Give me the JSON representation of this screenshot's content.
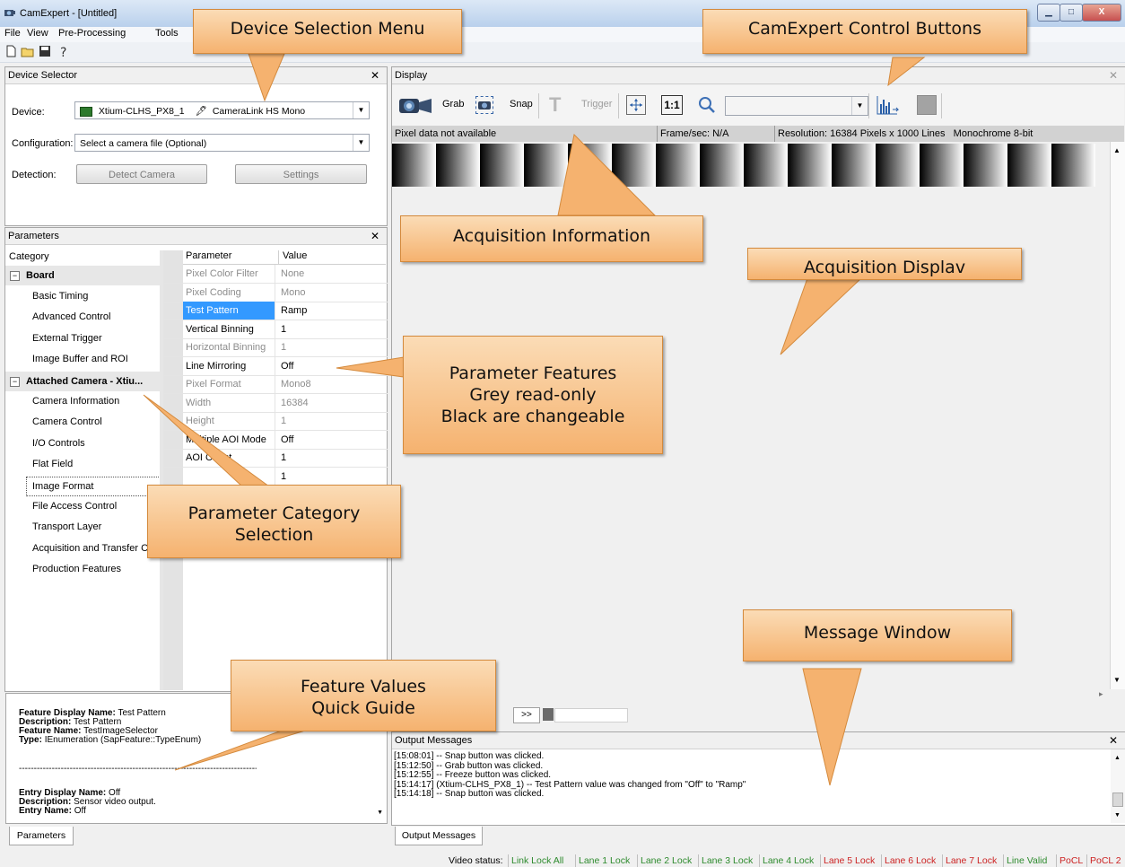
{
  "window": {
    "title": "CamExpert - [Untitled]",
    "min": "▁",
    "max": "□",
    "close": "X"
  },
  "menu": [
    "File",
    "View",
    "Pre-Processing",
    "Tools"
  ],
  "device_selector": {
    "header": "Device Selector",
    "device_label": "Device:",
    "device_value": "Xtium-CLHS_PX8_1",
    "device_type": "CameraLink HS Mono",
    "config_label": "Configuration:",
    "config_value": "Select a camera file (Optional)",
    "detection_label": "Detection:",
    "detect_button": "Detect Camera",
    "settings_button": "Settings"
  },
  "parameters": {
    "header": "Parameters",
    "col_category": "Category",
    "col_parameter": "Parameter",
    "col_value": "Value",
    "categories": [
      {
        "label": "Board",
        "group": true
      },
      {
        "label": "Basic Timing"
      },
      {
        "label": "Advanced Control"
      },
      {
        "label": "External Trigger"
      },
      {
        "label": "Image Buffer and ROI"
      },
      {
        "label": "Attached Camera - Xtiu...",
        "group": true
      },
      {
        "label": "Camera Information"
      },
      {
        "label": "Camera Control"
      },
      {
        "label": "I/O Controls"
      },
      {
        "label": "Flat Field"
      },
      {
        "label": "Image Format"
      },
      {
        "label": "File Access Control"
      },
      {
        "label": "Transport Layer"
      },
      {
        "label": "Acquisition and Transfer C"
      },
      {
        "label": "Production Features"
      }
    ],
    "rows": [
      {
        "name": "Pixel Color Filter",
        "value": "None",
        "readonly": true
      },
      {
        "name": "Pixel Coding",
        "value": "Mono",
        "readonly": true
      },
      {
        "name": "Test Pattern",
        "value": "Ramp",
        "selected": true
      },
      {
        "name": "Vertical Binning",
        "value": "1"
      },
      {
        "name": "Horizontal Binning",
        "value": "1",
        "readonly": true
      },
      {
        "name": "Line Mirroring",
        "value": "Off"
      },
      {
        "name": "Pixel Format",
        "value": "Mono8",
        "readonly": true
      },
      {
        "name": "Width",
        "value": "16384",
        "readonly": true
      },
      {
        "name": "Height",
        "value": "1",
        "readonly": true
      },
      {
        "name": "Multiple AOI Mode",
        "value": "Off"
      },
      {
        "name": "AOI Count",
        "value": "1"
      },
      {
        "name": "",
        "value": "1"
      }
    ],
    "info": {
      "l1_key": "Feature Display Name:",
      "l1_val": "Test Pattern",
      "l2_key": "Description:",
      "l2_val": "Test Pattern",
      "l3_key": "Feature Name:",
      "l3_val": "TestImageSelector",
      "l4_key": "Type:",
      "l4_val": "IEnumeration (SapFeature::TypeEnum)",
      "sep": "----------------------------------------------------------------------------------------",
      "l5_key": "Entry Display Name:",
      "l5_val": "Off",
      "l6_key": "Description:",
      "l6_val": "Sensor video output.",
      "l7_key": "Entry Name:",
      "l7_val": "Off"
    },
    "tab": "Parameters"
  },
  "display": {
    "header": "Display",
    "grab": "Grab",
    "snap": "Snap",
    "trigger": "Trigger",
    "one_to_one": "1:1",
    "pixel_info": "Pixel data not available",
    "fps": "Frame/sec: N/A",
    "resolution": "Resolution: 16384 Pixels x 1000 Lines   Monochrome 8-bit",
    "nav_next": ">>"
  },
  "output": {
    "header": "Output Messages",
    "messages": [
      "[15:08:01] -- Snap button was clicked.",
      "[15:12:50] -- Grab button was clicked.",
      "[15:12:55] -- Freeze button was clicked.",
      "[15:14:17] (Xtium-CLHS_PX8_1)  -- Test Pattern value was changed from \"Off\" to \"Ramp\"",
      "[15:14:18] -- Snap button was clicked."
    ],
    "tab": "Output Messages"
  },
  "video_status": {
    "label": "Video status:",
    "items": [
      {
        "text": "Link Lock All",
        "color": "#2e8b2e"
      },
      {
        "text": "Lane 1 Lock",
        "color": "#2e8b2e"
      },
      {
        "text": "Lane 2 Lock",
        "color": "#2e8b2e"
      },
      {
        "text": "Lane 3 Lock",
        "color": "#2e8b2e"
      },
      {
        "text": "Lane 4 Lock",
        "color": "#2e8b2e"
      },
      {
        "text": "Lane 5 Lock",
        "color": "#cc2222"
      },
      {
        "text": "Lane 6 Lock",
        "color": "#cc2222"
      },
      {
        "text": "Lane 7 Lock",
        "color": "#cc2222"
      },
      {
        "text": "Line Valid",
        "color": "#2e8b2e"
      },
      {
        "text": "PoCL",
        "color": "#cc2222"
      },
      {
        "text": "PoCL 2",
        "color": "#cc2222"
      }
    ]
  },
  "callouts": {
    "device_selection_menu": "Device Selection Menu",
    "control_buttons": "CamExpert Control Buttons",
    "acquisition_information": "Acquisition Information",
    "acquisition_display": "Acquisition Displav",
    "parameter_features": "Parameter Features\nGrey read-only\nBlack are changeable",
    "parameter_category": "Parameter Category\nSelection",
    "message_window": "Message Window",
    "feature_values": "Feature Values\nQuick Guide"
  },
  "colors": {
    "callout_fill": "#f7c48e",
    "selection_blue": "#3399ff"
  }
}
